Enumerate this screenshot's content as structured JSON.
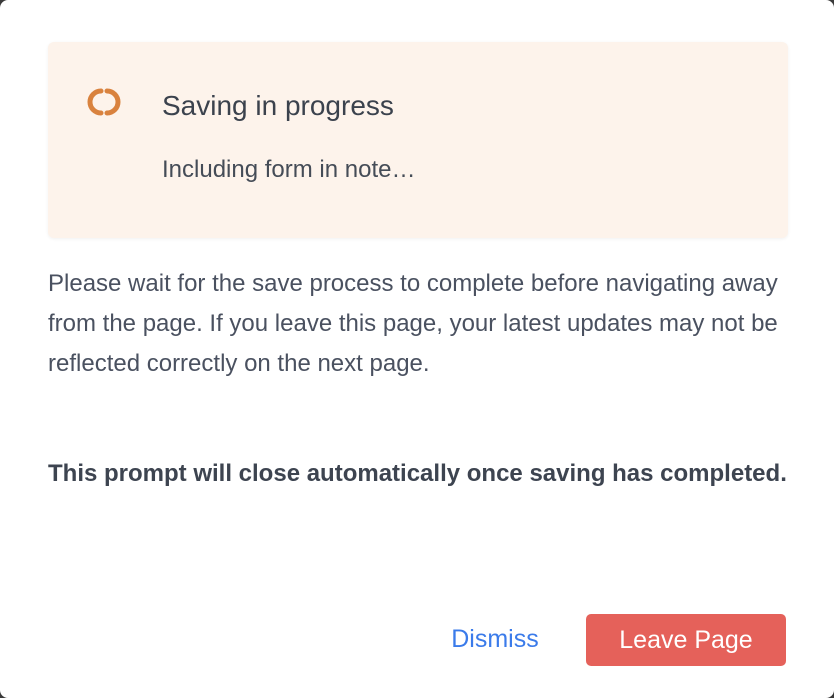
{
  "status": {
    "icon": "loading-spinner-icon",
    "title": "Saving in progress",
    "subtitle": "Including form in note…"
  },
  "message": {
    "body": "Please wait for the save process to complete before navigating away from the page. If you leave this page, your latest updates may not be reflected correctly on the next page.",
    "note": "This prompt will close automatically once saving has completed."
  },
  "actions": {
    "dismiss_label": "Dismiss",
    "leave_label": "Leave Page"
  },
  "colors": {
    "card_background": "#fdf3eb",
    "spinner": "#d9823e",
    "link": "#3b7bea",
    "danger": "#e5615a"
  }
}
